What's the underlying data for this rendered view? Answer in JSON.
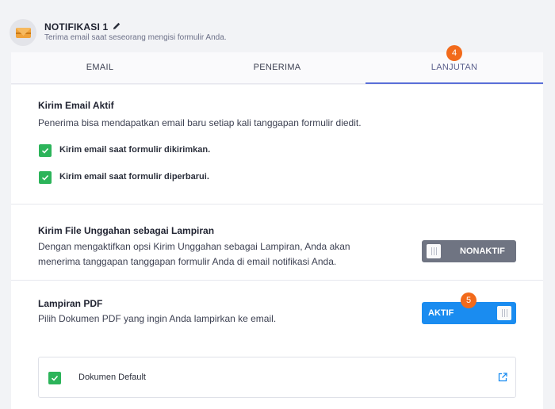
{
  "header": {
    "title": "NOTIFIKASI 1",
    "subtitle": "Terima email saat seseorang mengisi formulir Anda."
  },
  "tabs": [
    {
      "label": "EMAIL",
      "active": false
    },
    {
      "label": "PENERIMA",
      "active": false
    },
    {
      "label": "LANJUTAN",
      "active": true
    }
  ],
  "badges": {
    "tab_badge": "4",
    "toggle_badge": "5"
  },
  "active_email": {
    "heading": "Kirim Email Aktif",
    "description": "Penerima bisa mendapatkan email baru setiap kali tanggapan formulir diedit.",
    "options": [
      {
        "label": "Kirim email saat formulir dikirimkan.",
        "checked": true
      },
      {
        "label": "Kirim email saat formulir diperbarui.",
        "checked": true
      }
    ]
  },
  "attachments": {
    "heading": "Kirim File Unggahan sebagai Lampiran",
    "description_line1": "Dengan mengaktifkan opsi Kirim Unggahan sebagai Lampiran, Anda akan",
    "description_line2": "menerima tanggapan tanggapan formulir Anda di email notifikasi Anda.",
    "toggle_label": "NONAKTIF",
    "enabled": false
  },
  "pdf": {
    "heading": "Lampiran PDF",
    "description": "Pilih Dokumen PDF yang ingin Anda lampirkan ke email.",
    "toggle_label": "AKTIF",
    "enabled": true,
    "documents": [
      {
        "label": "Dokumen Default",
        "checked": true
      }
    ]
  },
  "colors": {
    "accent": "#5a6fd8",
    "badge": "#f26a1b",
    "checkbox": "#2cb45a",
    "toggle_on": "#1a8cf0",
    "toggle_off": "#6f7482"
  },
  "icons": [
    "envelope-icon",
    "pencil-icon",
    "check-icon",
    "external-link-icon",
    "toggle-grip-icon"
  ]
}
